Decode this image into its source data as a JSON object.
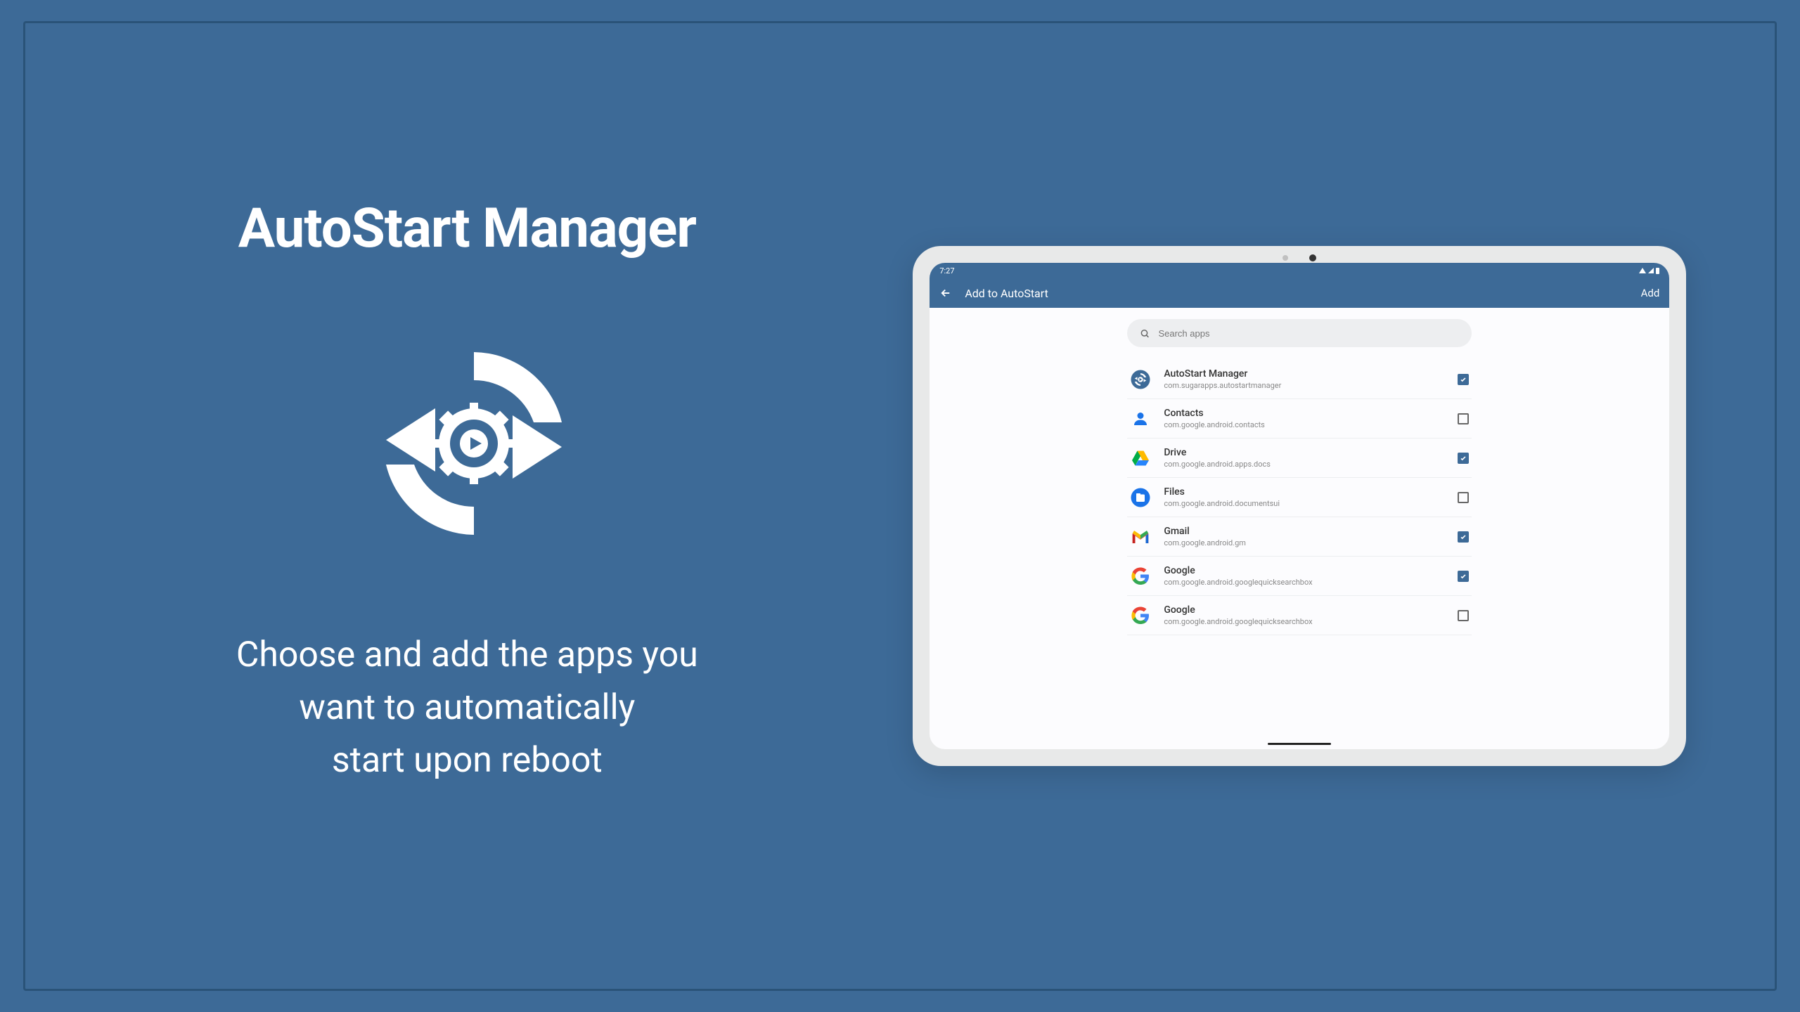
{
  "promo": {
    "title": "AutoStart Manager",
    "subtitle_l1": "Choose and add the apps you",
    "subtitle_l2": "want to automatically",
    "subtitle_l3": "start upon reboot"
  },
  "statusbar": {
    "time": "7:27"
  },
  "appbar": {
    "title": "Add to AutoStart",
    "action": "Add"
  },
  "search": {
    "placeholder": "Search apps"
  },
  "apps": [
    {
      "name": "AutoStart Manager",
      "pkg": "com.sugarapps.autostartmanager",
      "checked": true,
      "icon": "autostart"
    },
    {
      "name": "Contacts",
      "pkg": "com.google.android.contacts",
      "checked": false,
      "icon": "contacts"
    },
    {
      "name": "Drive",
      "pkg": "com.google.android.apps.docs",
      "checked": true,
      "icon": "drive"
    },
    {
      "name": "Files",
      "pkg": "com.google.android.documentsui",
      "checked": false,
      "icon": "files"
    },
    {
      "name": "Gmail",
      "pkg": "com.google.android.gm",
      "checked": true,
      "icon": "gmail"
    },
    {
      "name": "Google",
      "pkg": "com.google.android.googlequicksearchbox",
      "checked": true,
      "icon": "google"
    },
    {
      "name": "Google",
      "pkg": "com.google.android.googlequicksearchbox",
      "checked": false,
      "icon": "google"
    }
  ]
}
